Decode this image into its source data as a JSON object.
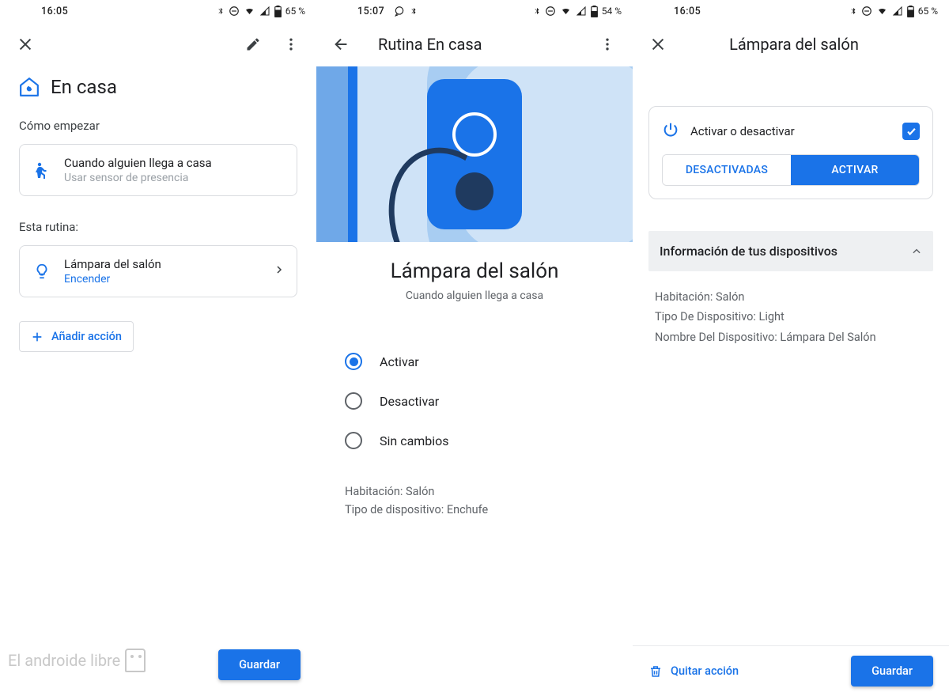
{
  "screens": {
    "s1": {
      "status": {
        "time": "16:05",
        "battery": "65 %"
      },
      "routine_name": "En casa",
      "section_start": "Cómo empezar",
      "trigger": {
        "title": "Cuando alguien llega a casa",
        "subtitle": "Usar sensor de presencia"
      },
      "section_actions": "Esta rutina:",
      "action": {
        "title": "Lámpara del salón",
        "state": "Encender"
      },
      "add_action": "Añadir acción",
      "save": "Guardar",
      "watermark": "El androide libre"
    },
    "s2": {
      "status": {
        "time": "15:07",
        "battery": "54 %"
      },
      "title": "Rutina En casa",
      "device_title": "Lámpara del salón",
      "device_sub": "Cuando alguien llega a casa",
      "options": [
        "Activar",
        "Desactivar",
        "Sin cambios"
      ],
      "selected": 0,
      "info_room_label": "Habitación:",
      "info_room_value": "Salón",
      "info_type_label": "Tipo de dispositivo:",
      "info_type_value": "Enchufe"
    },
    "s3": {
      "status": {
        "time": "16:05",
        "battery": "65 %"
      },
      "title": "Lámpara del salón",
      "toggle_label": "Activar o desactivar",
      "seg_off": "DESACTIVADAS",
      "seg_on": "ACTIVAR",
      "info_header": "Información de tus dispositivos",
      "info": {
        "room_label": "Habitación:",
        "room_value": "Salón",
        "type_label": "Tipo De Dispositivo:",
        "type_value": "Light",
        "name_label": "Nombre Del Dispositivo:",
        "name_value": "Lámpara Del Salón"
      },
      "remove": "Quitar acción",
      "save": "Guardar"
    }
  }
}
